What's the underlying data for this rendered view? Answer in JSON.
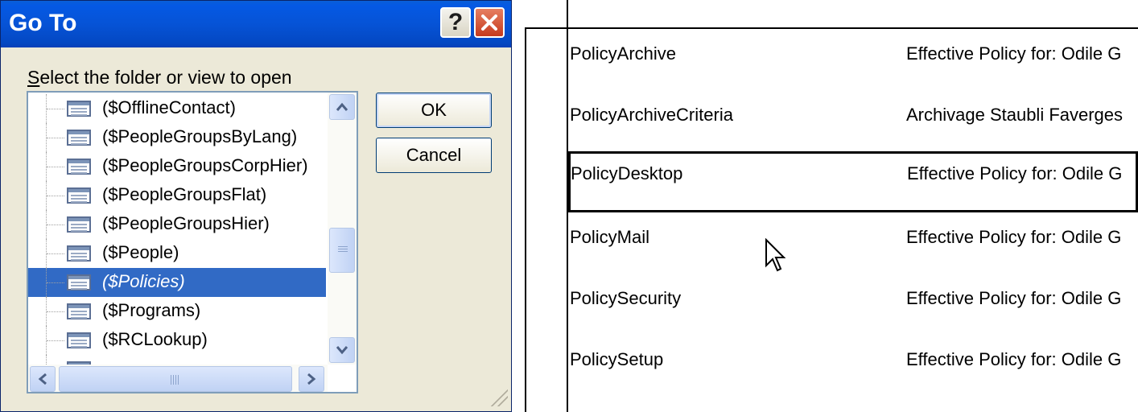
{
  "dialog": {
    "title": "Go To",
    "help_glyph": "?",
    "prompt_accel": "S",
    "prompt_rest": "elect the folder or view to open",
    "items": [
      {
        "label": "($OfflineContact)",
        "selected": false
      },
      {
        "label": "($PeopleGroupsByLang)",
        "selected": false
      },
      {
        "label": "($PeopleGroupsCorpHier)",
        "selected": false
      },
      {
        "label": "($PeopleGroupsFlat)",
        "selected": false
      },
      {
        "label": "($PeopleGroupsHier)",
        "selected": false
      },
      {
        "label": "($People)",
        "selected": false
      },
      {
        "label": "($Policies)",
        "selected": true
      },
      {
        "label": "($Programs)",
        "selected": false
      },
      {
        "label": "($RCLookup)",
        "selected": false
      }
    ],
    "ok_label": "OK",
    "cancel_label": "Cancel",
    "icons": {
      "title_help": "help-icon",
      "title_close": "close-icon",
      "view": "view-icon"
    }
  },
  "list": {
    "rows": [
      {
        "name": "PolicyArchive",
        "desc": "Effective Policy for: Odile G",
        "focused": false
      },
      {
        "name": "PolicyArchiveCriteria",
        "desc": "Archivage Staubli Faverges",
        "focused": false
      },
      {
        "name": "PolicyDesktop",
        "desc": "Effective Policy for: Odile G",
        "focused": true
      },
      {
        "name": "PolicyMail",
        "desc": "Effective Policy for: Odile G",
        "focused": false
      },
      {
        "name": "PolicySecurity",
        "desc": "Effective Policy for: Odile G",
        "focused": false
      },
      {
        "name": "PolicySetup",
        "desc": "Effective Policy for: Odile G",
        "focused": false
      }
    ]
  },
  "colors": {
    "title_bar": "#0559e4",
    "selection": "#316ac5",
    "dialog_bg": "#ece9d8"
  }
}
